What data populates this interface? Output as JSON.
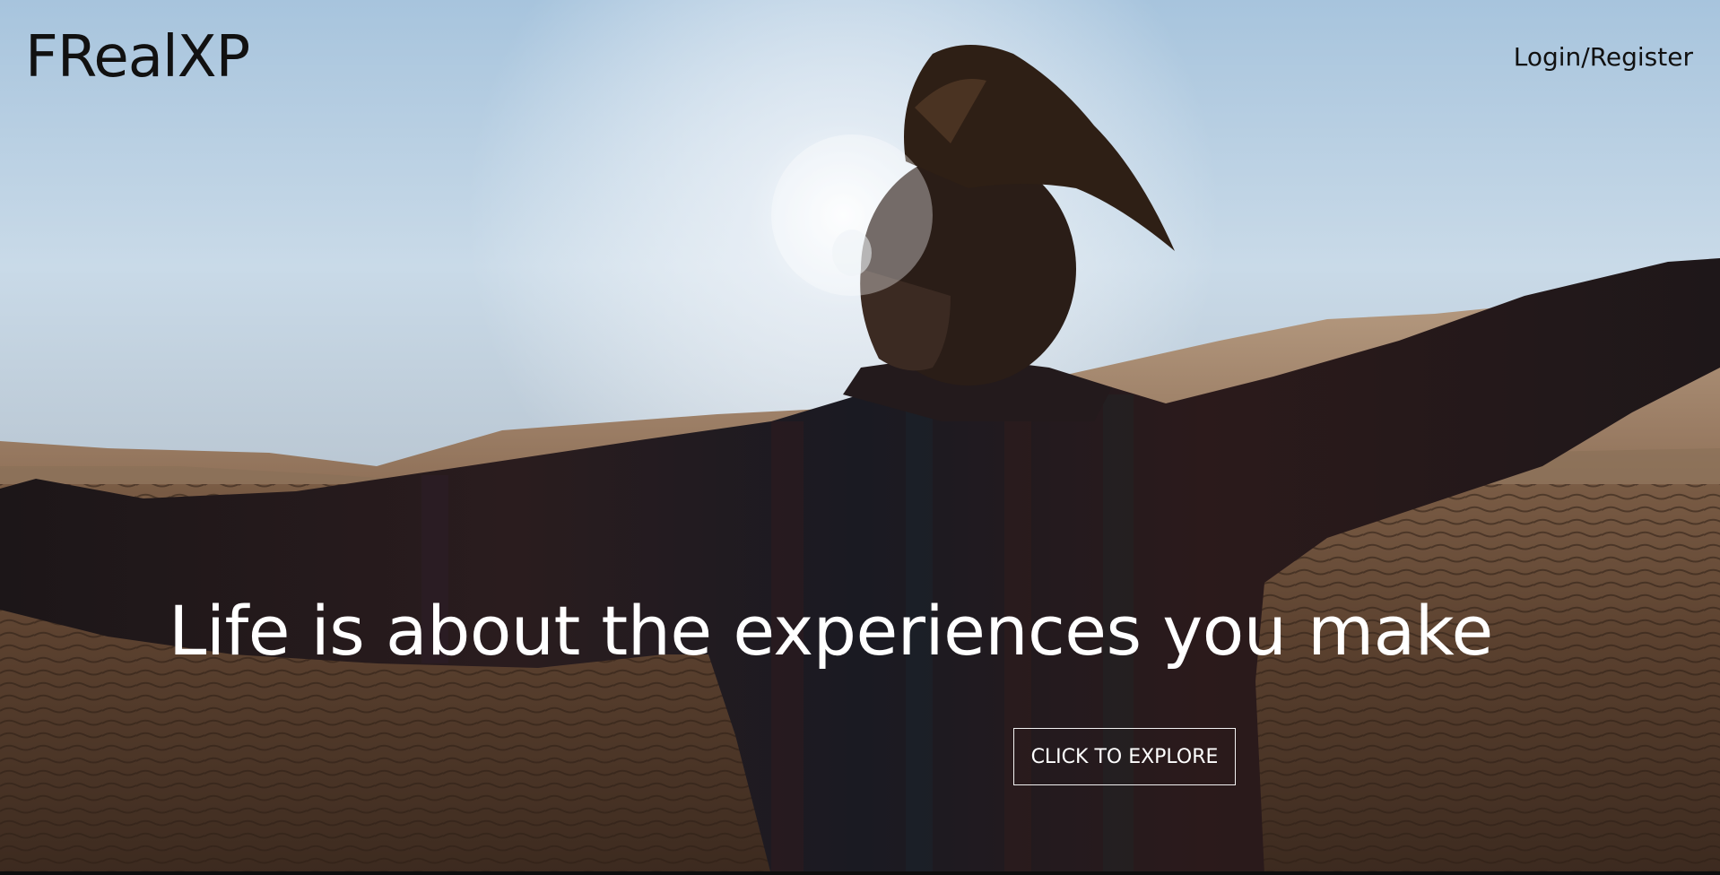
{
  "nav": {
    "logo_text": "FRealXP",
    "login_label": "Login/Register"
  },
  "hero": {
    "headline": "Life is about the experiences you make",
    "cta_label": "CLICK TO EXPLORE"
  },
  "colors": {
    "sky_top": "#a9c6de",
    "sky_glow": "#eef3f8",
    "dune": "#a8896e",
    "sand": "#5a4030",
    "sweater": "#22191a",
    "text_light": "#ffffff",
    "text_dark": "#111111"
  }
}
